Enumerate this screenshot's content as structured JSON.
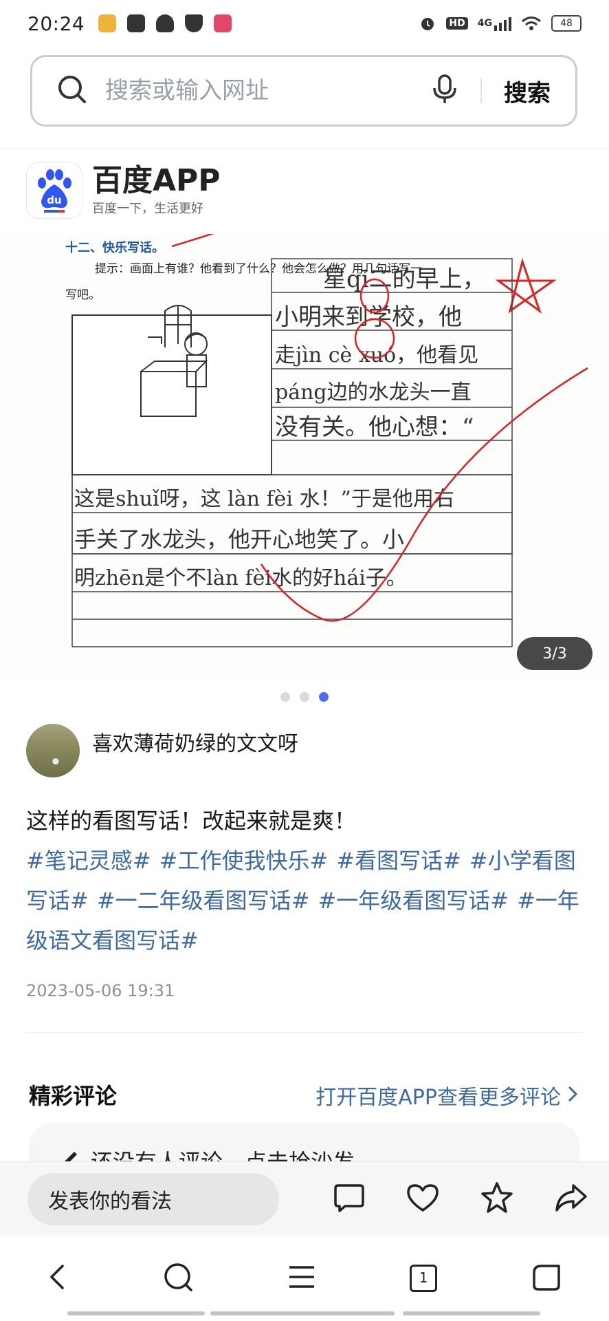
{
  "status_bar": {
    "time": "20:24",
    "network": "4G",
    "hd": "HD",
    "battery": "48",
    "app_icons": [
      {
        "name": "app-icon-1",
        "color": "#f0b23a"
      },
      {
        "name": "app-icon-2",
        "color": "#333333"
      },
      {
        "name": "app-icon-3",
        "color": "#333333"
      },
      {
        "name": "app-icon-4",
        "color": "#333333"
      },
      {
        "name": "app-icon-5",
        "color": "#e2476a"
      }
    ]
  },
  "search": {
    "placeholder": "搜索或输入网址",
    "button": "搜索"
  },
  "brand": {
    "name": "百度APP",
    "slogan": "百度一下，生活更好",
    "accent": "#2e57f2"
  },
  "worksheet": {
    "heading": "十二、快乐写话。",
    "prompt_line1": "提示：画面上有谁？他看到了什么？他会怎么做？用几句话写一",
    "prompt_line2": "写吧。",
    "rows": [
      "星qī二的早上，",
      "小明来到学校，他",
      "走jìn cè xuó，他看见",
      "páng边的水龙头一直",
      "没有关。他心想：“",
      "这是shuǐ呀，这 làn fèi 水！”于是他用右",
      "手关了水龙头，他开心地笑了。小",
      "明zhēn是个不làn fèi水的好hái子。"
    ]
  },
  "carousel": {
    "indicator": "3/3",
    "dot_count": 3,
    "active_dot": 2
  },
  "author": {
    "name": "喜欢薄荷奶绿的文文呀"
  },
  "post": {
    "text": "这样的看图写话！改起来就是爽！",
    "tags": [
      "#笔记灵感#",
      "#工作使我快乐#",
      "#看图写话#",
      "#小学看图写话#",
      "#一二年级看图写话#",
      "#一年级看图写话#",
      "#一年级语文看图写话#"
    ],
    "date": "2023-05-06 19:31"
  },
  "comments": {
    "title": "精彩评论",
    "more_link": "打开百度APP查看更多评论",
    "empty_text": "还没有人评论，点击抢沙发~"
  },
  "action_bar": {
    "input_placeholder": "发表你的看法",
    "icons": [
      "comment-icon",
      "like-icon",
      "favorite-icon",
      "share-icon"
    ]
  },
  "nav_bar": {
    "tab_count": "1",
    "icons": [
      "back-icon",
      "search-icon",
      "menu-icon",
      "tabs-icon",
      "home-icon"
    ]
  }
}
